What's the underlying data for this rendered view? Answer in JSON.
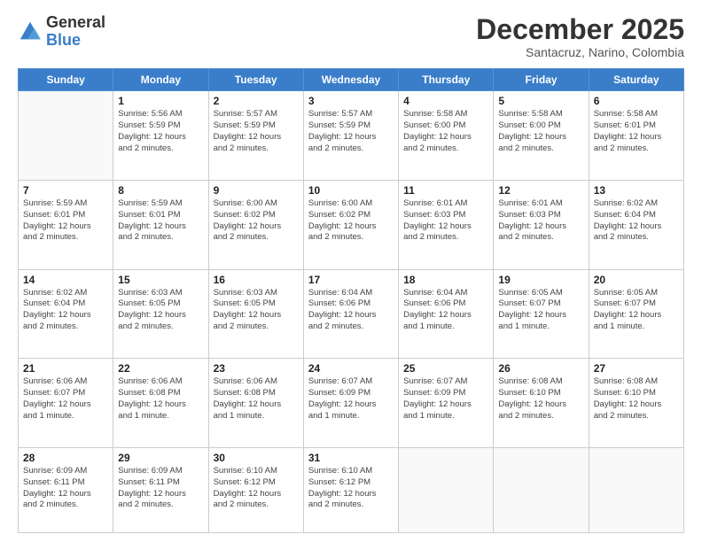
{
  "logo": {
    "general": "General",
    "blue": "Blue"
  },
  "title": "December 2025",
  "location": "Santacruz, Narino, Colombia",
  "days_header": [
    "Sunday",
    "Monday",
    "Tuesday",
    "Wednesday",
    "Thursday",
    "Friday",
    "Saturday"
  ],
  "weeks": [
    [
      {
        "day": "",
        "info": ""
      },
      {
        "day": "1",
        "info": "Sunrise: 5:56 AM\nSunset: 5:59 PM\nDaylight: 12 hours\nand 2 minutes."
      },
      {
        "day": "2",
        "info": "Sunrise: 5:57 AM\nSunset: 5:59 PM\nDaylight: 12 hours\nand 2 minutes."
      },
      {
        "day": "3",
        "info": "Sunrise: 5:57 AM\nSunset: 5:59 PM\nDaylight: 12 hours\nand 2 minutes."
      },
      {
        "day": "4",
        "info": "Sunrise: 5:58 AM\nSunset: 6:00 PM\nDaylight: 12 hours\nand 2 minutes."
      },
      {
        "day": "5",
        "info": "Sunrise: 5:58 AM\nSunset: 6:00 PM\nDaylight: 12 hours\nand 2 minutes."
      },
      {
        "day": "6",
        "info": "Sunrise: 5:58 AM\nSunset: 6:01 PM\nDaylight: 12 hours\nand 2 minutes."
      }
    ],
    [
      {
        "day": "7",
        "info": "Sunrise: 5:59 AM\nSunset: 6:01 PM\nDaylight: 12 hours\nand 2 minutes."
      },
      {
        "day": "8",
        "info": "Sunrise: 5:59 AM\nSunset: 6:01 PM\nDaylight: 12 hours\nand 2 minutes."
      },
      {
        "day": "9",
        "info": "Sunrise: 6:00 AM\nSunset: 6:02 PM\nDaylight: 12 hours\nand 2 minutes."
      },
      {
        "day": "10",
        "info": "Sunrise: 6:00 AM\nSunset: 6:02 PM\nDaylight: 12 hours\nand 2 minutes."
      },
      {
        "day": "11",
        "info": "Sunrise: 6:01 AM\nSunset: 6:03 PM\nDaylight: 12 hours\nand 2 minutes."
      },
      {
        "day": "12",
        "info": "Sunrise: 6:01 AM\nSunset: 6:03 PM\nDaylight: 12 hours\nand 2 minutes."
      },
      {
        "day": "13",
        "info": "Sunrise: 6:02 AM\nSunset: 6:04 PM\nDaylight: 12 hours\nand 2 minutes."
      }
    ],
    [
      {
        "day": "14",
        "info": "Sunrise: 6:02 AM\nSunset: 6:04 PM\nDaylight: 12 hours\nand 2 minutes."
      },
      {
        "day": "15",
        "info": "Sunrise: 6:03 AM\nSunset: 6:05 PM\nDaylight: 12 hours\nand 2 minutes."
      },
      {
        "day": "16",
        "info": "Sunrise: 6:03 AM\nSunset: 6:05 PM\nDaylight: 12 hours\nand 2 minutes."
      },
      {
        "day": "17",
        "info": "Sunrise: 6:04 AM\nSunset: 6:06 PM\nDaylight: 12 hours\nand 2 minutes."
      },
      {
        "day": "18",
        "info": "Sunrise: 6:04 AM\nSunset: 6:06 PM\nDaylight: 12 hours\nand 1 minute."
      },
      {
        "day": "19",
        "info": "Sunrise: 6:05 AM\nSunset: 6:07 PM\nDaylight: 12 hours\nand 1 minute."
      },
      {
        "day": "20",
        "info": "Sunrise: 6:05 AM\nSunset: 6:07 PM\nDaylight: 12 hours\nand 1 minute."
      }
    ],
    [
      {
        "day": "21",
        "info": "Sunrise: 6:06 AM\nSunset: 6:07 PM\nDaylight: 12 hours\nand 1 minute."
      },
      {
        "day": "22",
        "info": "Sunrise: 6:06 AM\nSunset: 6:08 PM\nDaylight: 12 hours\nand 1 minute."
      },
      {
        "day": "23",
        "info": "Sunrise: 6:06 AM\nSunset: 6:08 PM\nDaylight: 12 hours\nand 1 minute."
      },
      {
        "day": "24",
        "info": "Sunrise: 6:07 AM\nSunset: 6:09 PM\nDaylight: 12 hours\nand 1 minute."
      },
      {
        "day": "25",
        "info": "Sunrise: 6:07 AM\nSunset: 6:09 PM\nDaylight: 12 hours\nand 1 minute."
      },
      {
        "day": "26",
        "info": "Sunrise: 6:08 AM\nSunset: 6:10 PM\nDaylight: 12 hours\nand 2 minutes."
      },
      {
        "day": "27",
        "info": "Sunrise: 6:08 AM\nSunset: 6:10 PM\nDaylight: 12 hours\nand 2 minutes."
      }
    ],
    [
      {
        "day": "28",
        "info": "Sunrise: 6:09 AM\nSunset: 6:11 PM\nDaylight: 12 hours\nand 2 minutes."
      },
      {
        "day": "29",
        "info": "Sunrise: 6:09 AM\nSunset: 6:11 PM\nDaylight: 12 hours\nand 2 minutes."
      },
      {
        "day": "30",
        "info": "Sunrise: 6:10 AM\nSunset: 6:12 PM\nDaylight: 12 hours\nand 2 minutes."
      },
      {
        "day": "31",
        "info": "Sunrise: 6:10 AM\nSunset: 6:12 PM\nDaylight: 12 hours\nand 2 minutes."
      },
      {
        "day": "",
        "info": ""
      },
      {
        "day": "",
        "info": ""
      },
      {
        "day": "",
        "info": ""
      }
    ]
  ]
}
